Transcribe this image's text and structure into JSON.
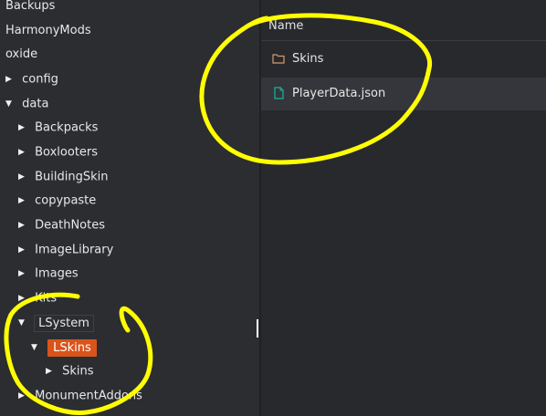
{
  "tree": {
    "items": [
      {
        "label": "Backups"
      },
      {
        "label": "HarmonyMods"
      },
      {
        "label": "oxide"
      },
      {
        "label": "config"
      },
      {
        "label": "data"
      },
      {
        "label": "Backpacks"
      },
      {
        "label": "Boxlooters"
      },
      {
        "label": "BuildingSkin"
      },
      {
        "label": "copypaste"
      },
      {
        "label": "DeathNotes"
      },
      {
        "label": "ImageLibrary"
      },
      {
        "label": "Images"
      },
      {
        "label": "Kits"
      },
      {
        "label": "LSystem"
      },
      {
        "label": "LSkins"
      },
      {
        "label": "Skins"
      },
      {
        "label": "MonumentAddons"
      }
    ]
  },
  "filepane": {
    "header": {
      "name_label": "Name"
    },
    "files": [
      {
        "label": "Skins",
        "icon": "folder-icon"
      },
      {
        "label": "PlayerData.json",
        "icon": "file-icon"
      }
    ]
  },
  "colors": {
    "selected": "#d9541b",
    "annotation": "#ffff00",
    "folder_icon": "#d69a6b",
    "json_icon": "#17b3a3"
  }
}
